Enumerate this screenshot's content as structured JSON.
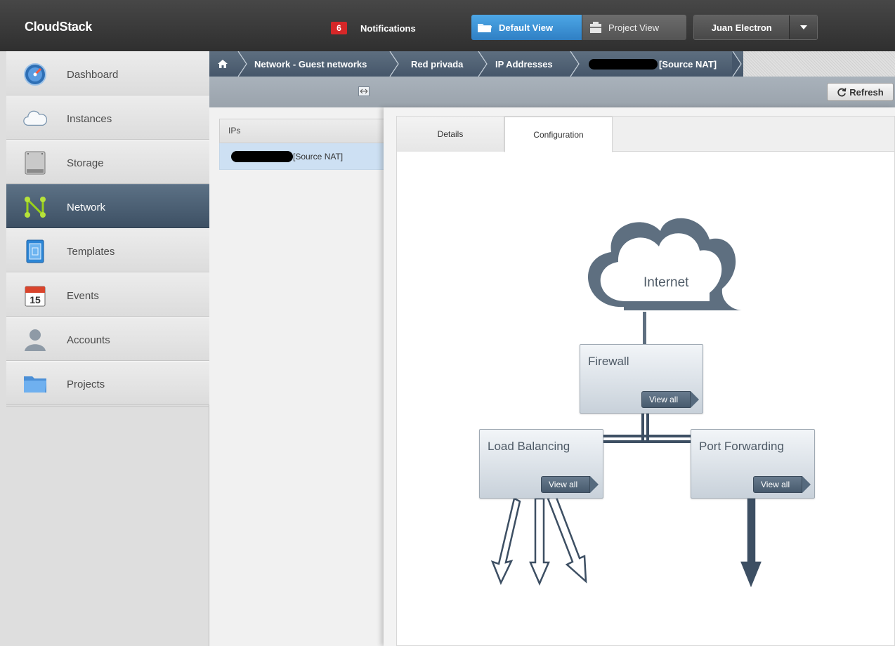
{
  "header": {
    "logo": "CloudStack",
    "notifications_count": "6",
    "notifications_label": "Notifications",
    "default_view_label": "Default View",
    "project_view_label": "Project View",
    "user_name": "Juan Electron"
  },
  "sidebar": {
    "items": [
      {
        "label": "Dashboard",
        "icon": "dashboard-gauge-icon"
      },
      {
        "label": "Instances",
        "icon": "cloud-icon"
      },
      {
        "label": "Storage",
        "icon": "hard-drive-icon"
      },
      {
        "label": "Network",
        "icon": "network-icon",
        "active": true
      },
      {
        "label": "Templates",
        "icon": "template-icon"
      },
      {
        "label": "Events",
        "icon": "calendar-icon",
        "calendar_day": "15"
      },
      {
        "label": "Accounts",
        "icon": "user-icon"
      },
      {
        "label": "Projects",
        "icon": "folder-icon"
      }
    ]
  },
  "breadcrumb": {
    "items": [
      "Network - Guest networks",
      "Red privada",
      "IP Addresses",
      "[Source NAT]"
    ]
  },
  "list": {
    "header": "IPs",
    "rows": [
      "[Source NAT]"
    ]
  },
  "detail": {
    "refresh_label": "Refresh",
    "tabs": [
      "Details",
      "Configuration"
    ],
    "active_tab": "Configuration"
  },
  "diagram": {
    "internet_label": "Internet",
    "firewall_label": "Firewall",
    "load_balancing_label": "Load Balancing",
    "port_forwarding_label": "Port Forwarding",
    "view_all_label": "View all"
  },
  "colors": {
    "active_nav": "#4a5d70",
    "accent_blue": "#3a8dd6",
    "notification_red": "#d62728",
    "diagram_stroke": "#3d4f63"
  }
}
